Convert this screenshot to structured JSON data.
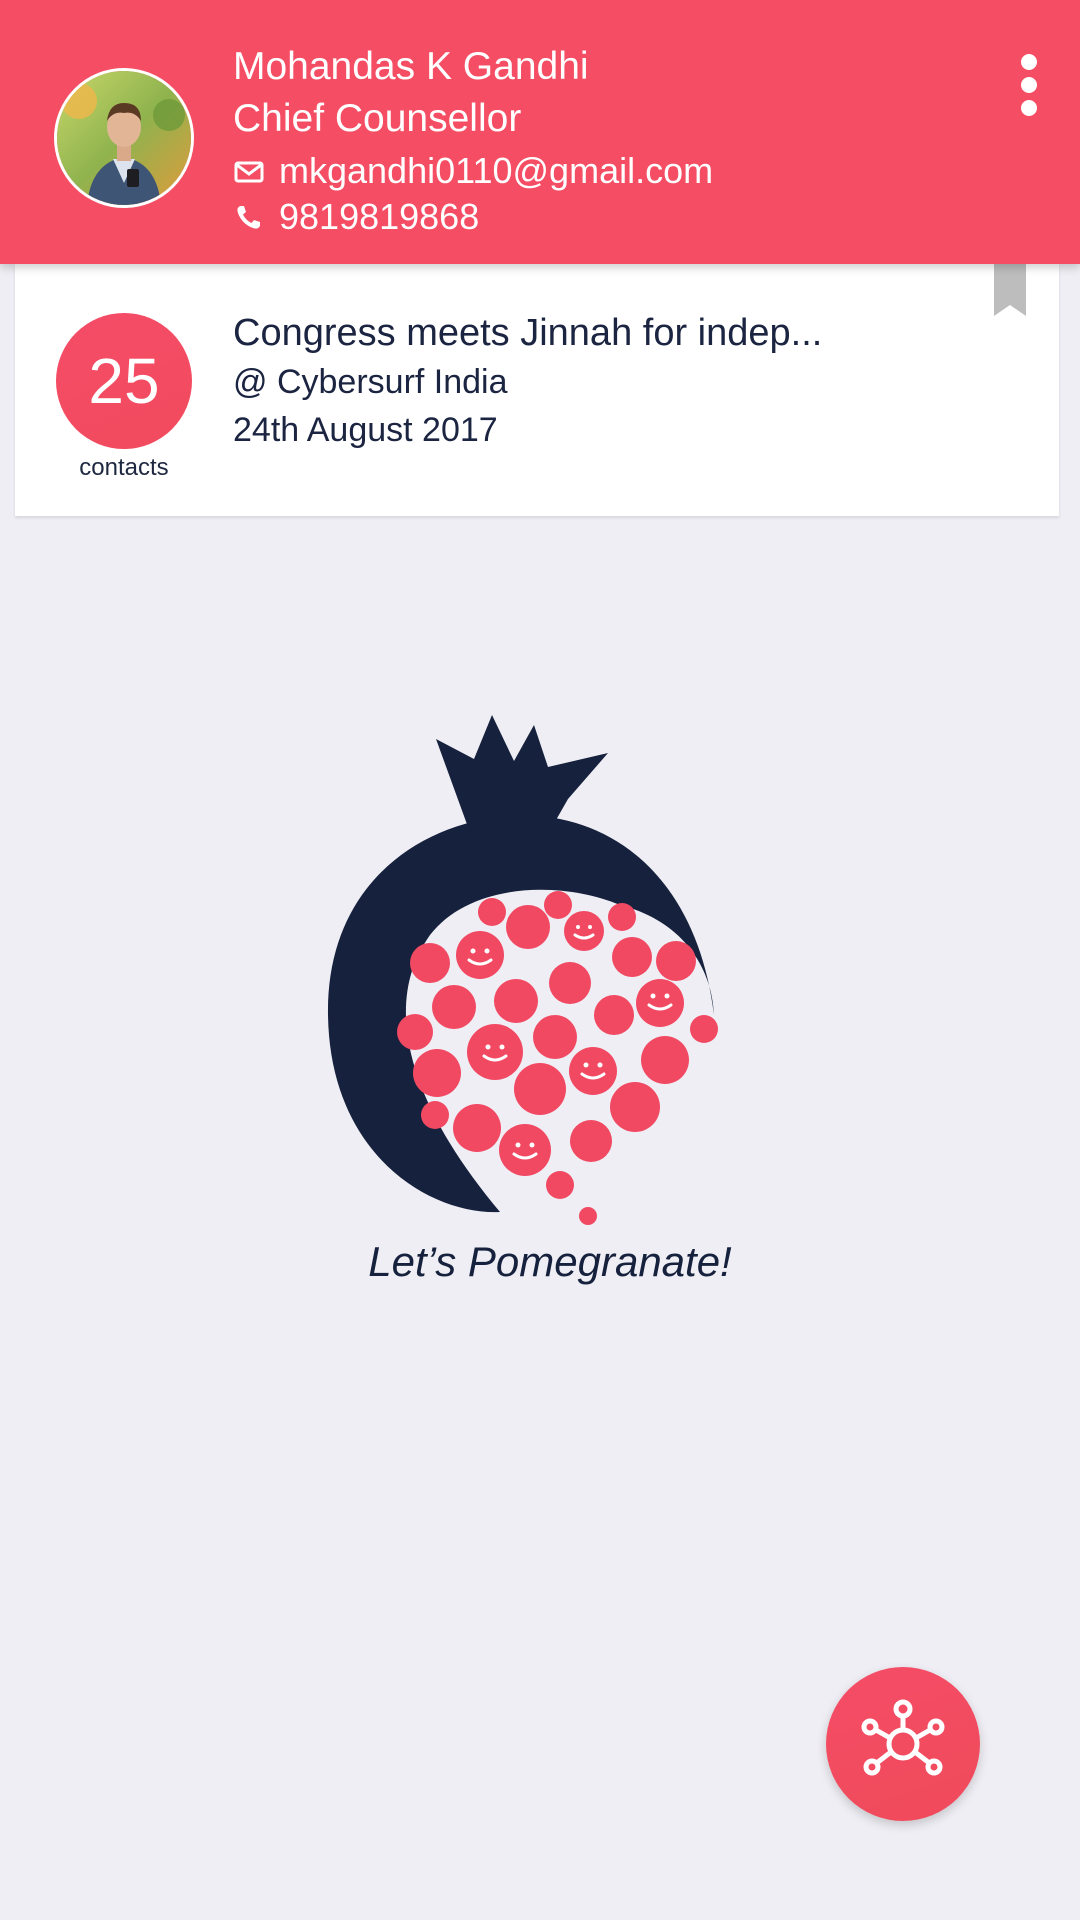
{
  "profile": {
    "name": "Mohandas K Gandhi",
    "title": "Chief Counsellor",
    "email": "mkgandhi0110@gmail.com",
    "phone": "9819819868"
  },
  "event": {
    "count": "25",
    "count_label": "contacts",
    "title": "Congress meets Jinnah for indep...",
    "venue": "@ Cybersurf India",
    "date": "24th August 2017"
  },
  "branding": {
    "tagline": "Let’s Pomegranate!"
  },
  "icons": {
    "email": "mail-icon",
    "phone": "phone-icon",
    "menu": "more-vert-icon",
    "bookmark": "bookmark-icon",
    "fab": "network-hub-icon"
  },
  "colors": {
    "accent": "#F54D63",
    "navy": "#16213D",
    "background": "#EFEEF4",
    "card": "#FFFFFF"
  }
}
